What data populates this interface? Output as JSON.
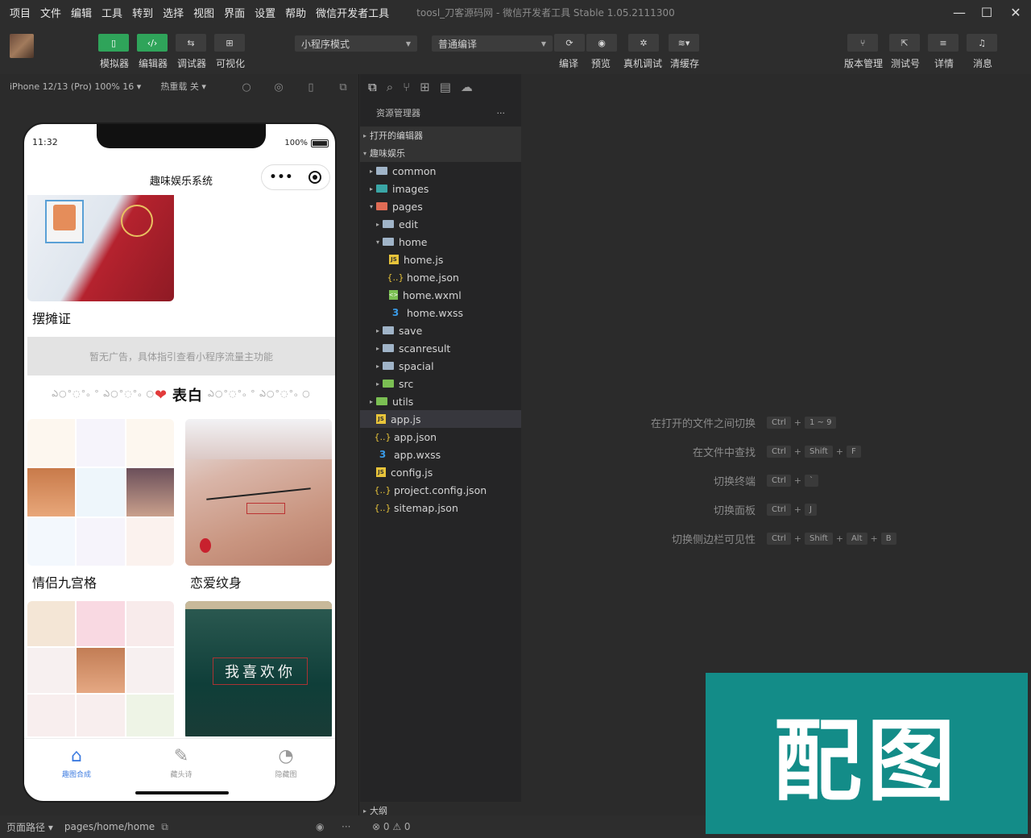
{
  "menu": [
    "项目",
    "文件",
    "编辑",
    "工具",
    "转到",
    "选择",
    "视图",
    "界面",
    "设置",
    "帮助",
    "微信开发者工具"
  ],
  "window_title": "toosl_刀客源码网 - 微信开发者工具 Stable 1.05.2111300",
  "toolbar": {
    "simulator": "模拟器",
    "editor": "编辑器",
    "debugger": "调试器",
    "visual": "可视化",
    "mode_select": "小程序模式",
    "compile_select": "普通编译",
    "compile": "编译",
    "preview": "预览",
    "real_debug": "真机调试",
    "clear_cache": "清缓存",
    "version_mgmt": "版本管理",
    "test_account": "测试号",
    "details": "详情",
    "messages": "消息"
  },
  "simulator": {
    "device": "iPhone 12/13 (Pro) 100% 16 ▾",
    "hot_reload": "热重载 关 ▾",
    "phone": {
      "time": "11:32",
      "battery": "100%",
      "nav_title": "趣味娱乐系统",
      "cards": [
        {
          "title": "摆摊证"
        },
        {
          "title": "情侣九宫格"
        },
        {
          "title": "恋爱纹身"
        }
      ],
      "ad_text": "暂无广告，具体指引查看小程序流量主功能",
      "biaobai_deco": "ఎ○°◌°ₒ ° ఎ○°◌°ₒ ○",
      "biaobai_word": "表白",
      "tabs": [
        {
          "label": "趣图合成",
          "icon": "⌂"
        },
        {
          "label": "藏头诗",
          "icon": "✎"
        },
        {
          "label": "隐藏图",
          "icon": "◔"
        }
      ]
    }
  },
  "explorer": {
    "header": "资源管理器",
    "more": "···",
    "open_editors": "打开的编辑器",
    "project": "趣味娱乐",
    "outline": "大纲",
    "tree": [
      {
        "name": "common",
        "indent": 1,
        "type": "folder",
        "arrow": "▸"
      },
      {
        "name": "images",
        "indent": 1,
        "type": "folder-images",
        "arrow": "▸"
      },
      {
        "name": "pages",
        "indent": 1,
        "type": "folder-pages",
        "arrow": "▾"
      },
      {
        "name": "edit",
        "indent": 2,
        "type": "folder",
        "arrow": "▸"
      },
      {
        "name": "home",
        "indent": 2,
        "type": "folder-open",
        "arrow": "▾"
      },
      {
        "name": "home.js",
        "indent": 3,
        "type": "js",
        "arrow": ""
      },
      {
        "name": "home.json",
        "indent": 3,
        "type": "json",
        "arrow": ""
      },
      {
        "name": "home.wxml",
        "indent": 3,
        "type": "wxml",
        "arrow": ""
      },
      {
        "name": "home.wxss",
        "indent": 3,
        "type": "wxss",
        "arrow": ""
      },
      {
        "name": "save",
        "indent": 2,
        "type": "folder",
        "arrow": "▸"
      },
      {
        "name": "scanresult",
        "indent": 2,
        "type": "folder",
        "arrow": "▸"
      },
      {
        "name": "spacial",
        "indent": 2,
        "type": "folder",
        "arrow": "▸"
      },
      {
        "name": "src",
        "indent": 2,
        "type": "folder-src",
        "arrow": "▸"
      },
      {
        "name": "utils",
        "indent": 1,
        "type": "folder-utils",
        "arrow": "▸"
      },
      {
        "name": "app.js",
        "indent": 1,
        "type": "js",
        "arrow": "",
        "selected": true
      },
      {
        "name": "app.json",
        "indent": 1,
        "type": "json",
        "arrow": ""
      },
      {
        "name": "app.wxss",
        "indent": 1,
        "type": "wxss",
        "arrow": ""
      },
      {
        "name": "config.js",
        "indent": 1,
        "type": "js",
        "arrow": ""
      },
      {
        "name": "project.config.json",
        "indent": 1,
        "type": "json",
        "arrow": ""
      },
      {
        "name": "sitemap.json",
        "indent": 1,
        "type": "json",
        "arrow": ""
      }
    ]
  },
  "shortcuts": [
    {
      "label": "在打开的文件之间切换",
      "keys": [
        "Ctrl",
        "1 ~ 9"
      ]
    },
    {
      "label": "在文件中查找",
      "keys": [
        "Ctrl",
        "Shift",
        "F"
      ]
    },
    {
      "label": "切换终端",
      "keys": [
        "Ctrl",
        "`"
      ]
    },
    {
      "label": "切换面板",
      "keys": [
        "Ctrl",
        "J"
      ]
    },
    {
      "label": "切换侧边栏可见性",
      "keys": [
        "Ctrl",
        "Shift",
        "Alt",
        "B"
      ]
    }
  ],
  "statusbar": {
    "path_label": "页面路径 ▾",
    "path": "pages/home/home",
    "errors": "⊗ 0 ⚠ 0"
  },
  "watermark": "配图"
}
